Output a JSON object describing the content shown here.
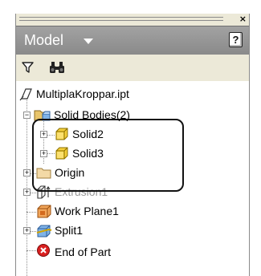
{
  "panel": {
    "close_glyph": "×",
    "header": {
      "title": "Model",
      "help_glyph": "?"
    },
    "toolbar": {
      "filter_icon": "filter-icon",
      "find_icon": "binoculars-icon"
    }
  },
  "tree": {
    "root": {
      "label": "MultiplaKroppar.ipt",
      "icon": "part-file-icon"
    },
    "solid_bodies": {
      "label": "Solid Bodies(2)",
      "icon": "solid-bodies-folder-icon",
      "expander": "−"
    },
    "solid2": {
      "label": "Solid2",
      "icon": "solid-body-icon",
      "expander": "+"
    },
    "solid3": {
      "label": "Solid3",
      "icon": "solid-body-icon",
      "expander": "+"
    },
    "origin": {
      "label": "Origin",
      "icon": "folder-icon",
      "expander": "+"
    },
    "extrusion1": {
      "label": "Extrusion1",
      "icon": "extrusion-icon",
      "expander": "+",
      "state": "disabled"
    },
    "work_plane1": {
      "label": "Work Plane1",
      "icon": "work-plane-icon"
    },
    "split1": {
      "label": "Split1",
      "icon": "split-icon",
      "expander": "+"
    },
    "end_of_part": {
      "label": "End of Part",
      "icon": "end-of-part-icon"
    }
  },
  "colors": {
    "header_bg": "#949494",
    "folder_yellow": "#f5cf3a",
    "disabled_text": "#9a9a9a",
    "end_of_part_red": "#d92020"
  }
}
